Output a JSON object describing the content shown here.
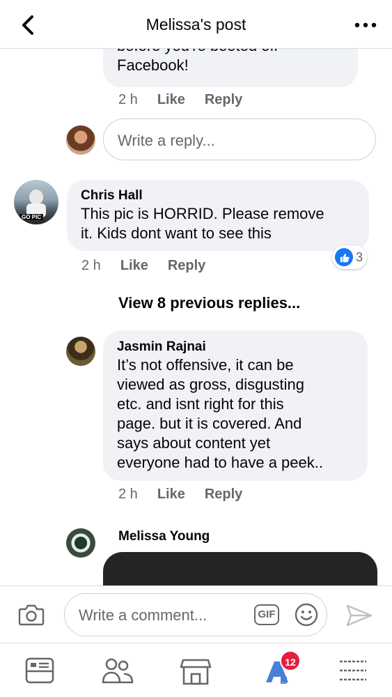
{
  "header": {
    "title": "Melissa's post"
  },
  "comments": [
    {
      "text_tail": "Facebook!",
      "text_clipped": "before you're booted off",
      "time": "2 h",
      "like": "Like",
      "reply": "Reply"
    }
  ],
  "reply_input": {
    "placeholder": "Write a reply..."
  },
  "chris": {
    "name": "Chris Hall",
    "line1": "This pic is HORRID. Please remove",
    "line2": "it. Kids dont want to see this",
    "time": "2 h",
    "like": "Like",
    "reply": "Reply",
    "reaction_count": "3",
    "avatar_caption": "GO PIC"
  },
  "view_previous": "View 8 previous replies...",
  "jasmin": {
    "name": "Jasmin Rajnai",
    "lines": [
      "It’s not offensive, it can be",
      "viewed as gross, disgusting",
      "etc. and isnt right for this",
      "page.  but it is covered. And",
      "says about content yet",
      "everyone had to have a peek.."
    ],
    "time": "2 h",
    "like": "Like",
    "reply": "Reply"
  },
  "melissa": {
    "name": "Melissa Young"
  },
  "composer": {
    "placeholder": "Write a comment...",
    "gif_label": "GIF"
  },
  "tabbar": {
    "items": [
      "news-feed",
      "groups",
      "marketplace",
      "notifications",
      "menu"
    ],
    "notification_count": "12"
  },
  "colors": {
    "accent": "#1877f2",
    "bubble": "#f0f2f5",
    "badge": "#e41e3f"
  }
}
